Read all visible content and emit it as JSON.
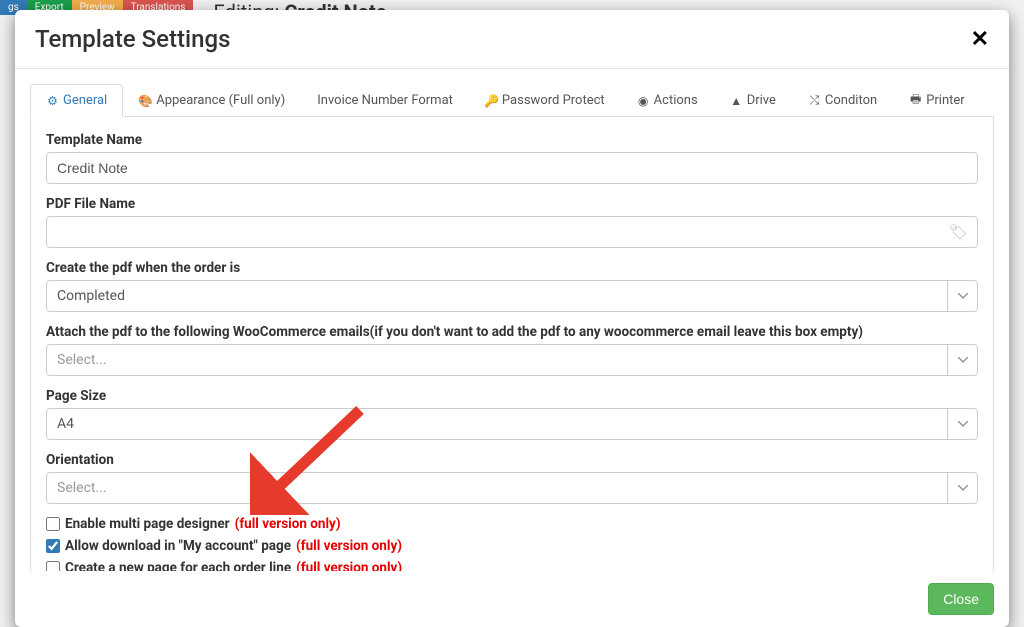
{
  "bg": {
    "editing_label": "Editing:",
    "editing_value": "Credit Note",
    "buttons": [
      "gs",
      "Export",
      "Preview",
      "Translations"
    ]
  },
  "modal": {
    "title": "Template Settings",
    "close_button": "Close"
  },
  "tabs": {
    "general": "General",
    "appearance": "Appearance (Full only)",
    "invoice_number": "Invoice Number Format",
    "password": "Password Protect",
    "actions": "Actions",
    "drive": "Drive",
    "condition": "Conditon",
    "printer": "Printer"
  },
  "form": {
    "template_name": {
      "label": "Template Name",
      "value": "Credit Note"
    },
    "pdf_file_name": {
      "label": "PDF File Name",
      "value": ""
    },
    "create_when": {
      "label": "Create the pdf when the order is",
      "value": "Completed"
    },
    "attach_emails": {
      "label": "Attach the pdf to the following WooCommerce emails(if you don't want to add the pdf to any woocommerce email leave this box empty)",
      "placeholder": "Select..."
    },
    "page_size": {
      "label": "Page Size",
      "value": "A4"
    },
    "orientation": {
      "label": "Orientation",
      "placeholder": "Select..."
    },
    "multi_page": {
      "label": "Enable multi page designer ",
      "suffix": "(full version only)",
      "checked": false
    },
    "allow_download": {
      "label": "Allow download in \"My account\" page ",
      "suffix": "(full version only)",
      "checked": true
    },
    "new_page_per_line": {
      "label": "Create a new page for each order line ",
      "suffix": "(full version only)",
      "checked": false
    }
  }
}
